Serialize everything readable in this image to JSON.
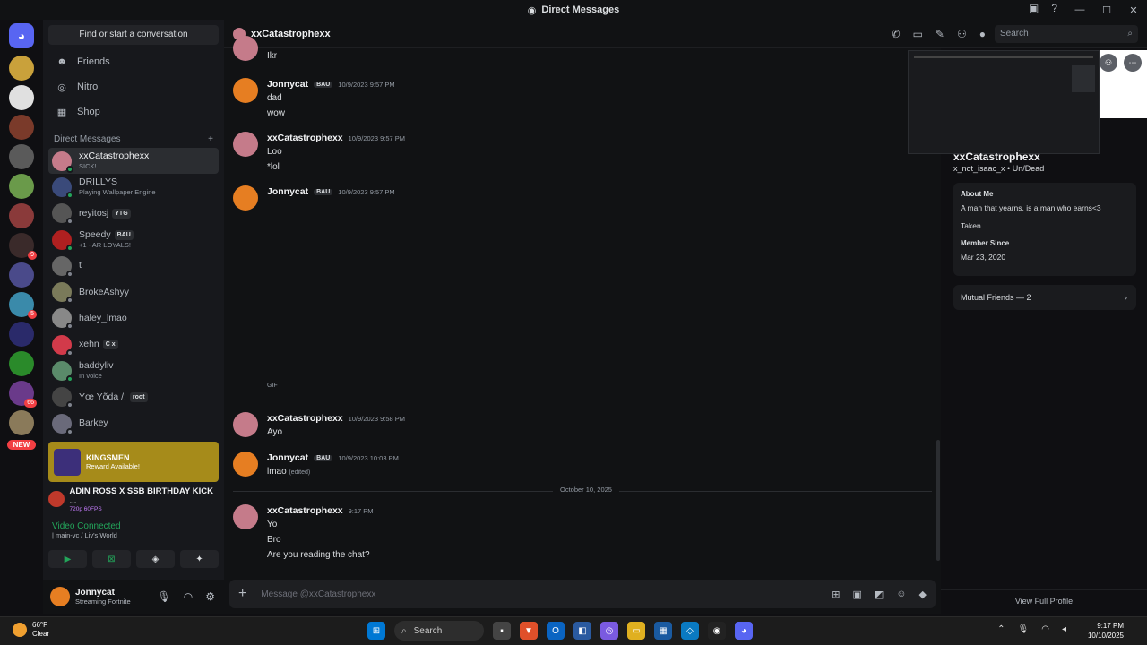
{
  "window": {
    "title": "Direct Messages"
  },
  "sidebar": {
    "find": "Find or start a conversation",
    "nav": [
      {
        "label": "Friends",
        "icon": "friends-icon",
        "glyph": "☻"
      },
      {
        "label": "Nitro",
        "icon": "nitro-icon",
        "glyph": "◎"
      },
      {
        "label": "Shop",
        "icon": "shop-icon",
        "glyph": "▦"
      }
    ],
    "dm_header": "Direct Messages",
    "dms": [
      {
        "name": "xxCatastrophexx",
        "sub": "SICK!",
        "tag": "",
        "color": "#c57b8a",
        "online": true,
        "active": true
      },
      {
        "name": "DRILLYS",
        "sub": "Playing Wallpaper Engine",
        "tag": "",
        "color": "#3a4a7a",
        "online": true,
        "active": false
      },
      {
        "name": "reyitosj",
        "sub": "",
        "tag": "YTG",
        "color": "#555",
        "online": false,
        "active": false
      },
      {
        "name": "Speedy",
        "sub": "+1 - AR LOYALS!",
        "tag": "BAU",
        "color": "#b02020",
        "online": true,
        "active": false
      },
      {
        "name": "t",
        "sub": "",
        "tag": "",
        "color": "#666",
        "online": false,
        "active": false
      },
      {
        "name": "BrokeAshyy",
        "sub": "",
        "tag": "",
        "color": "#7a7a5a",
        "online": false,
        "active": false
      },
      {
        "name": "haley_lmao",
        "sub": "",
        "tag": "",
        "color": "#888",
        "online": false,
        "active": false
      },
      {
        "name": "xehn",
        "sub": "",
        "tag": "C x",
        "color": "#d23a4a",
        "online": false,
        "active": false
      },
      {
        "name": "baddyliv",
        "sub": "In voice",
        "tag": "",
        "color": "#5a8a6a",
        "online": true,
        "active": false
      },
      {
        "name": "Yœ Yõda /:",
        "sub": "",
        "tag": "root",
        "color": "#444",
        "online": false,
        "active": false
      },
      {
        "name": "Barkey",
        "sub": "",
        "tag": "",
        "color": "#6a6a7a",
        "online": false,
        "active": false
      }
    ],
    "quest": {
      "title": "KINGSMEN",
      "sub": "Reward Available!"
    },
    "stream": {
      "title": "ADIN ROSS X SSB BIRTHDAY KICK ...",
      "sub": "720p 60FPS"
    },
    "voice": {
      "title": "Video Connected",
      "sub": "| main-vc / Liv's World"
    },
    "user": {
      "name": "Jonnycat",
      "sub": "Streaming Fortnite"
    }
  },
  "chat": {
    "recipient": "xxCatastrophexx",
    "search_placeholder": "Search",
    "gif_label": "GIF",
    "date_divider": "October 10, 2025",
    "composer_placeholder": "Message @xxCatastrophexx",
    "edited": "(edited)",
    "top_line": "Ikr",
    "messages": [
      {
        "author": "Jonnycat",
        "tag": "BAU",
        "time": "10/9/2023 9:57 PM",
        "lines": [
          "dad",
          "wow"
        ],
        "color": "#e67e22"
      },
      {
        "author": "xxCatastrophexx",
        "tag": "",
        "time": "10/9/2023 9:57 PM",
        "lines": [
          "Loo",
          "*lol"
        ],
        "color": "#c57b8a"
      },
      {
        "author": "Jonnycat",
        "tag": "BAU",
        "time": "10/9/2023 9:57 PM",
        "lines": [],
        "color": "#e67e22"
      },
      {
        "author": "xxCatastrophexx",
        "tag": "",
        "time": "10/9/2023 9:58 PM",
        "lines": [
          "Ayo"
        ],
        "color": "#c57b8a"
      },
      {
        "author": "Jonnycat",
        "tag": "BAU",
        "time": "10/9/2023 10:03 PM",
        "lines": [
          "lmao"
        ],
        "color": "#e67e22"
      },
      {
        "author": "xxCatastrophexx",
        "tag": "",
        "time": "9:17 PM",
        "lines": [
          "Yo",
          "Bro",
          "Are you reading the chat?"
        ],
        "color": "#c57b8a"
      }
    ]
  },
  "profile": {
    "name": "xxCatastrophexx",
    "username": "x_not_isaac_x • Un/Dead",
    "about_label": "About Me",
    "about": "A man that yearns, is a man who earns<3",
    "taken": "Taken",
    "member_since_label": "Member Since",
    "member_since": "Mar 23, 2020",
    "mutual": "Mutual Friends — 2",
    "view_full": "View Full Profile"
  },
  "taskbar": {
    "temp": "66°F",
    "weather": "Clear",
    "search": "Search",
    "time": "9:17 PM",
    "date": "10/10/2025"
  }
}
